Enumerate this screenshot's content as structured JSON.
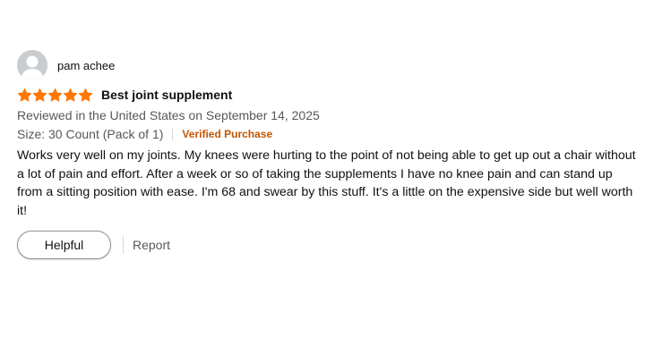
{
  "review": {
    "profile": {
      "name": "pam achee",
      "avatar_icon": "default-user-avatar-icon"
    },
    "rating": {
      "value": 5,
      "max": 5,
      "star_color": "#ff7700"
    },
    "title": "Best joint supplement",
    "date": "Reviewed in the United States on September 14, 2025",
    "variant": "Size: 30 Count (Pack of 1)",
    "verified_label": "Verified Purchase",
    "verified_color": "#c45500",
    "body": "Works very well on my joints. My knees were hurting to the point of not being able to get up out a chair without a lot of pain and effort. After a week or so of taking the supplements I have no knee pain and can stand up from a sitting position with ease. I'm 68 and swear by this stuff. It's a little on the expensive side but well worth it!",
    "actions": {
      "helpful_label": "Helpful",
      "report_label": "Report"
    }
  }
}
